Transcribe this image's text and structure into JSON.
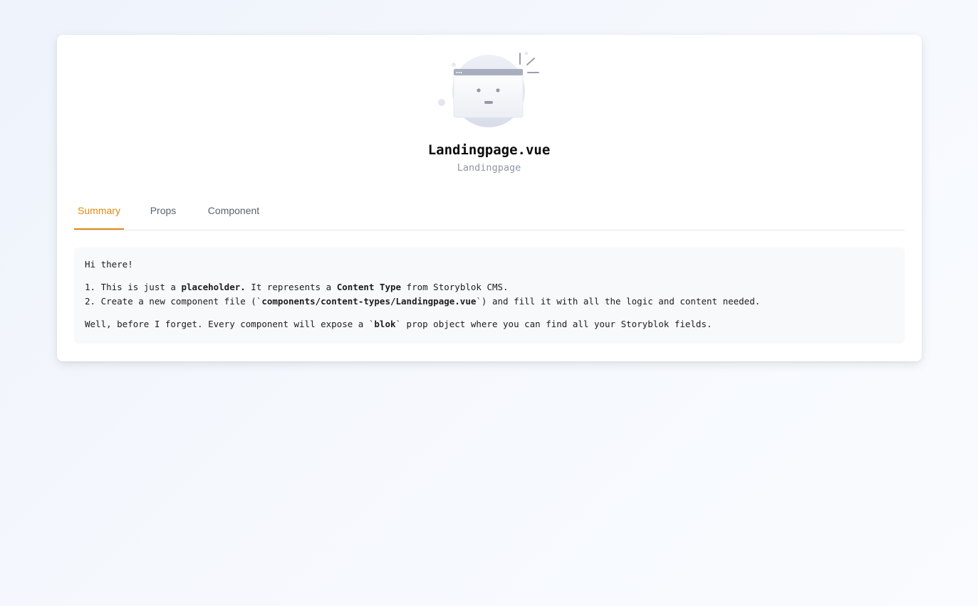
{
  "header": {
    "title": "Landingpage.vue",
    "subtitle": "Landingpage",
    "illustration_icon": "placeholder-window-face-icon"
  },
  "tabs": [
    {
      "label": "Summary",
      "active": true
    },
    {
      "label": "Props",
      "active": false
    },
    {
      "label": "Component",
      "active": false
    }
  ],
  "summary": {
    "greeting": "Hi there!",
    "line1": {
      "prefix": "1. This is just a ",
      "bold1": "placeholder.",
      "mid": " It represents a ",
      "bold2": "Content Type",
      "suffix": " from Storyblok CMS."
    },
    "line2": {
      "prefix": "2. Create a new component file (`",
      "bold": "components/content-types/Landingpage.vue",
      "suffix": "`) and fill it with all the logic and content needed."
    },
    "line3": {
      "prefix": "Well, before I forget. Every component will expose a `",
      "bold": "blok",
      "suffix": "` prop object where you can find all your Storyblok fields."
    }
  },
  "colors": {
    "accent": "#e08a12",
    "tab_text": "#5b6272",
    "subtitle": "#8f95a3"
  }
}
